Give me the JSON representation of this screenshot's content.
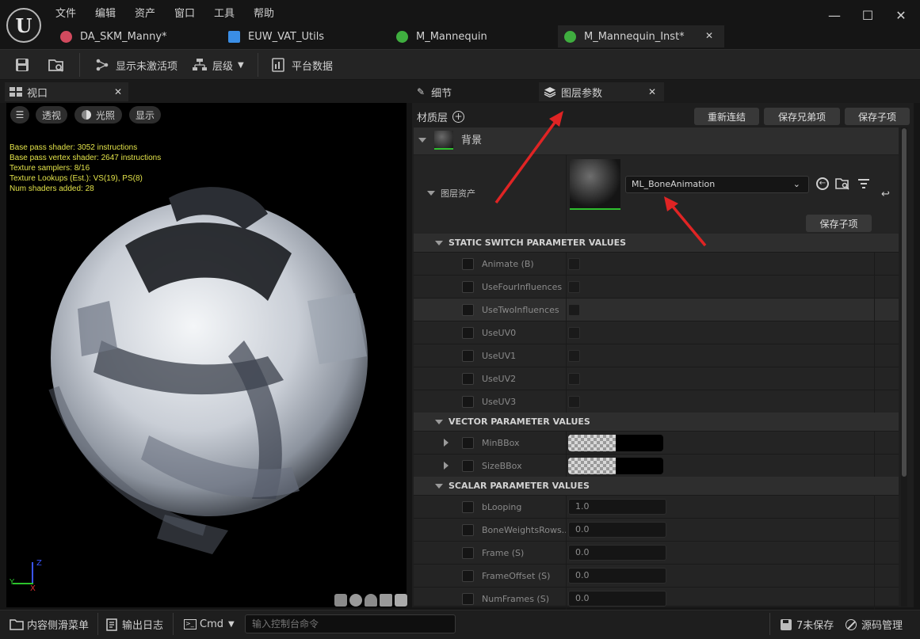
{
  "menu": [
    "文件",
    "编辑",
    "资产",
    "窗口",
    "工具",
    "帮助"
  ],
  "tabs": [
    {
      "label": "DA_SKM_Manny*",
      "color": "#d24a5e"
    },
    {
      "label": "EUW_VAT_Utils",
      "color": "#3a8ee6"
    },
    {
      "label": "M_Mannequin",
      "color": "#3fae3f"
    },
    {
      "label": "M_Mannequin_Inst*",
      "color": "#3fae3f",
      "active": true
    }
  ],
  "toolbar": {
    "show_inactive": "显示未激活项",
    "hierarchy": "层级",
    "platform_data": "平台数据"
  },
  "viewport": {
    "tab": "视口",
    "buttons": [
      "透视",
      "光照",
      "显示"
    ],
    "stats": [
      "Base pass shader: 3052 instructions",
      "Base pass vertex shader: 2647 instructions",
      "Texture samplers: 8/16",
      "Texture Lookups (Est.): VS(19), PS(8)",
      "Num shaders added: 28"
    ],
    "axis": {
      "z": "Z",
      "y": "Y",
      "x": "X"
    }
  },
  "details_tab": "细节",
  "layer_tab": "图层参数",
  "layer_panel": {
    "material_layers": "材质层",
    "btn_relink": "重新连结",
    "btn_save_siblings": "保存兄弟项",
    "btn_save_children": "保存子项",
    "background": "背景",
    "layer_asset": "图层资产",
    "asset_value": "ML_BoneAnimation",
    "asset_save_children": "保存子项"
  },
  "sections": {
    "static": "STATIC SWITCH PARAMETER VALUES",
    "vector": "VECTOR PARAMETER VALUES",
    "scalar": "SCALAR PARAMETER VALUES"
  },
  "static_params": [
    "Animate (B)",
    "UseFourInfluences",
    "UseTwoInfluences",
    "UseUV0",
    "UseUV1",
    "UseUV2",
    "UseUV3"
  ],
  "vector_params": [
    "MinBBox",
    "SizeBBox"
  ],
  "scalar_params": [
    {
      "name": "bLooping",
      "value": "1.0"
    },
    {
      "name": "BoneWeightsRows...",
      "value": "0.0"
    },
    {
      "name": "Frame (S)",
      "value": "0.0"
    },
    {
      "name": "FrameOffset (S)",
      "value": "0.0"
    },
    {
      "name": "NumFrames (S)",
      "value": "0.0"
    }
  ],
  "status": {
    "content_drawer": "内容侧滑菜单",
    "output_log": "输出日志",
    "cmd": "Cmd",
    "console_placeholder": "输入控制台命令",
    "unsaved": "7未保存",
    "source_control": "源码管理"
  },
  "colors": {
    "accent_green": "#2fbf2f",
    "annotation_red": "#e02424"
  }
}
